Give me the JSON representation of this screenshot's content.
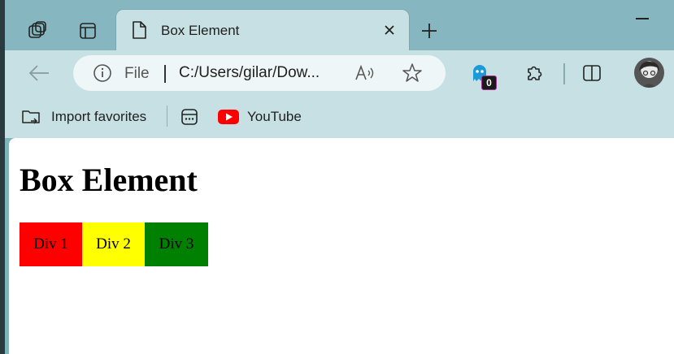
{
  "tab": {
    "title": "Box Element",
    "close_symbol": "✕",
    "new_tab_symbol": "+"
  },
  "omnibox": {
    "scheme_label": "File",
    "url": "C:/Users/gilar/Dow...",
    "read_aloud_label": "A"
  },
  "extensions": {
    "ghostery_count": "0"
  },
  "favorites": {
    "import_label": "Import favorites",
    "youtube_label": "YouTube"
  },
  "page": {
    "heading": "Box Element",
    "boxes": [
      {
        "label": "Div 1",
        "color": "#ff0000"
      },
      {
        "label": "Div 2",
        "color": "#ffff00"
      },
      {
        "label": "Div 3",
        "color": "#008000"
      }
    ]
  },
  "colors": {
    "tab_strip": "#86b6bf",
    "toolbar": "#c7e0e4",
    "omnibox": "#eef6f7",
    "youtube_red": "#ff0000"
  }
}
